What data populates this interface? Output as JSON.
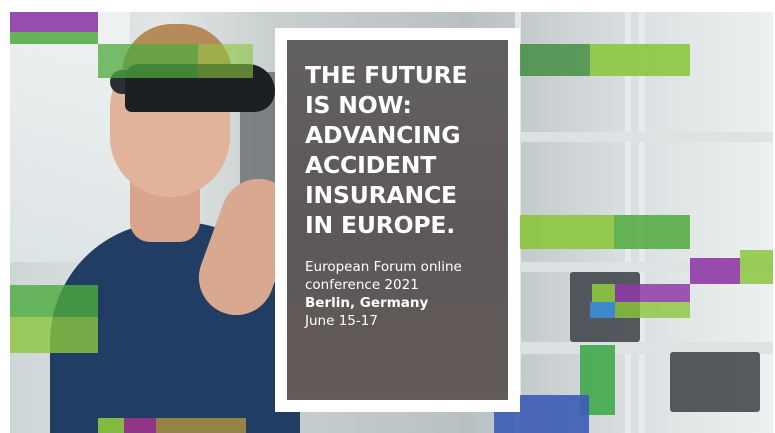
{
  "banner": {
    "title_lines": [
      "THE FUTURE",
      "IS NOW:",
      "ADVANCING",
      "ACCIDENT",
      "INSURANCE",
      "IN EUROPE."
    ],
    "event_lines": [
      "European Forum online",
      "conference 2021",
      "Berlin, Germany",
      "June 15-17"
    ]
  },
  "colors": {
    "lime": "#8cc63f",
    "green": "#4daa3d",
    "dark_green": "#3b8a3a",
    "purple": "#8e3aa6",
    "blue": "#3b5bb5",
    "panel_border": "#ffffff",
    "text": "#ffffff"
  }
}
